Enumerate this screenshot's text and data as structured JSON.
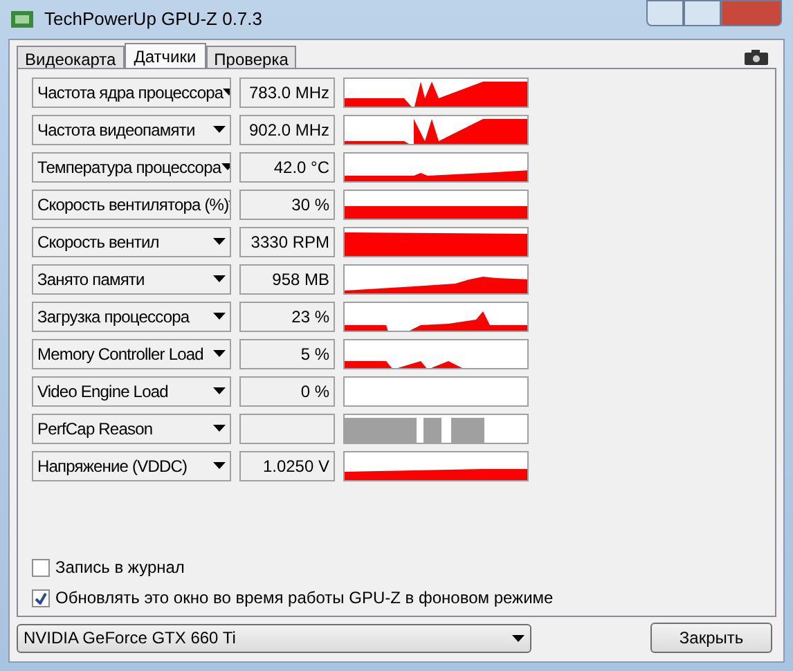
{
  "window": {
    "title": "TechPowerUp GPU-Z 0.7.3"
  },
  "tabs": [
    {
      "label": "Видеокарта",
      "selected": false
    },
    {
      "label": "Датчики",
      "selected": true
    },
    {
      "label": "Проверка",
      "selected": false
    }
  ],
  "sensors": [
    {
      "label": "Частота ядра процессора",
      "value": "783.0 MHz",
      "kind": "graph"
    },
    {
      "label": "Частота видеопамяти",
      "value": "902.0 MHz",
      "kind": "graph"
    },
    {
      "label": "Температура процессора",
      "value": "42.0 °C",
      "kind": "graph"
    },
    {
      "label": "Скорость вентилятора (%)",
      "value": "30 %",
      "kind": "graph"
    },
    {
      "label": "Скорость вентил",
      "value": "3330 RPM",
      "kind": "graph"
    },
    {
      "label": "Занято памяти",
      "value": "958 MB",
      "kind": "graph"
    },
    {
      "label": "Загрузка процессора",
      "value": "23 %",
      "kind": "graph"
    },
    {
      "label": "Memory Controller Load",
      "value": "5 %",
      "kind": "graph"
    },
    {
      "label": "Video Engine Load",
      "value": "0 %",
      "kind": "graph"
    },
    {
      "label": "PerfCap Reason",
      "kind": "blocks"
    },
    {
      "label": "Напряжение (VDDC)",
      "value": "1.0250 V",
      "kind": "graph"
    }
  ],
  "options": [
    {
      "label": "Запись в журнал",
      "checked": false
    },
    {
      "label": "Обновлять это окно во время работы GPU-Z в фоновом режиме",
      "checked": true
    }
  ],
  "device": {
    "value": "NVIDIA GeForce GTX 660 Ti"
  },
  "buttons": [
    "Закрыть"
  ]
}
